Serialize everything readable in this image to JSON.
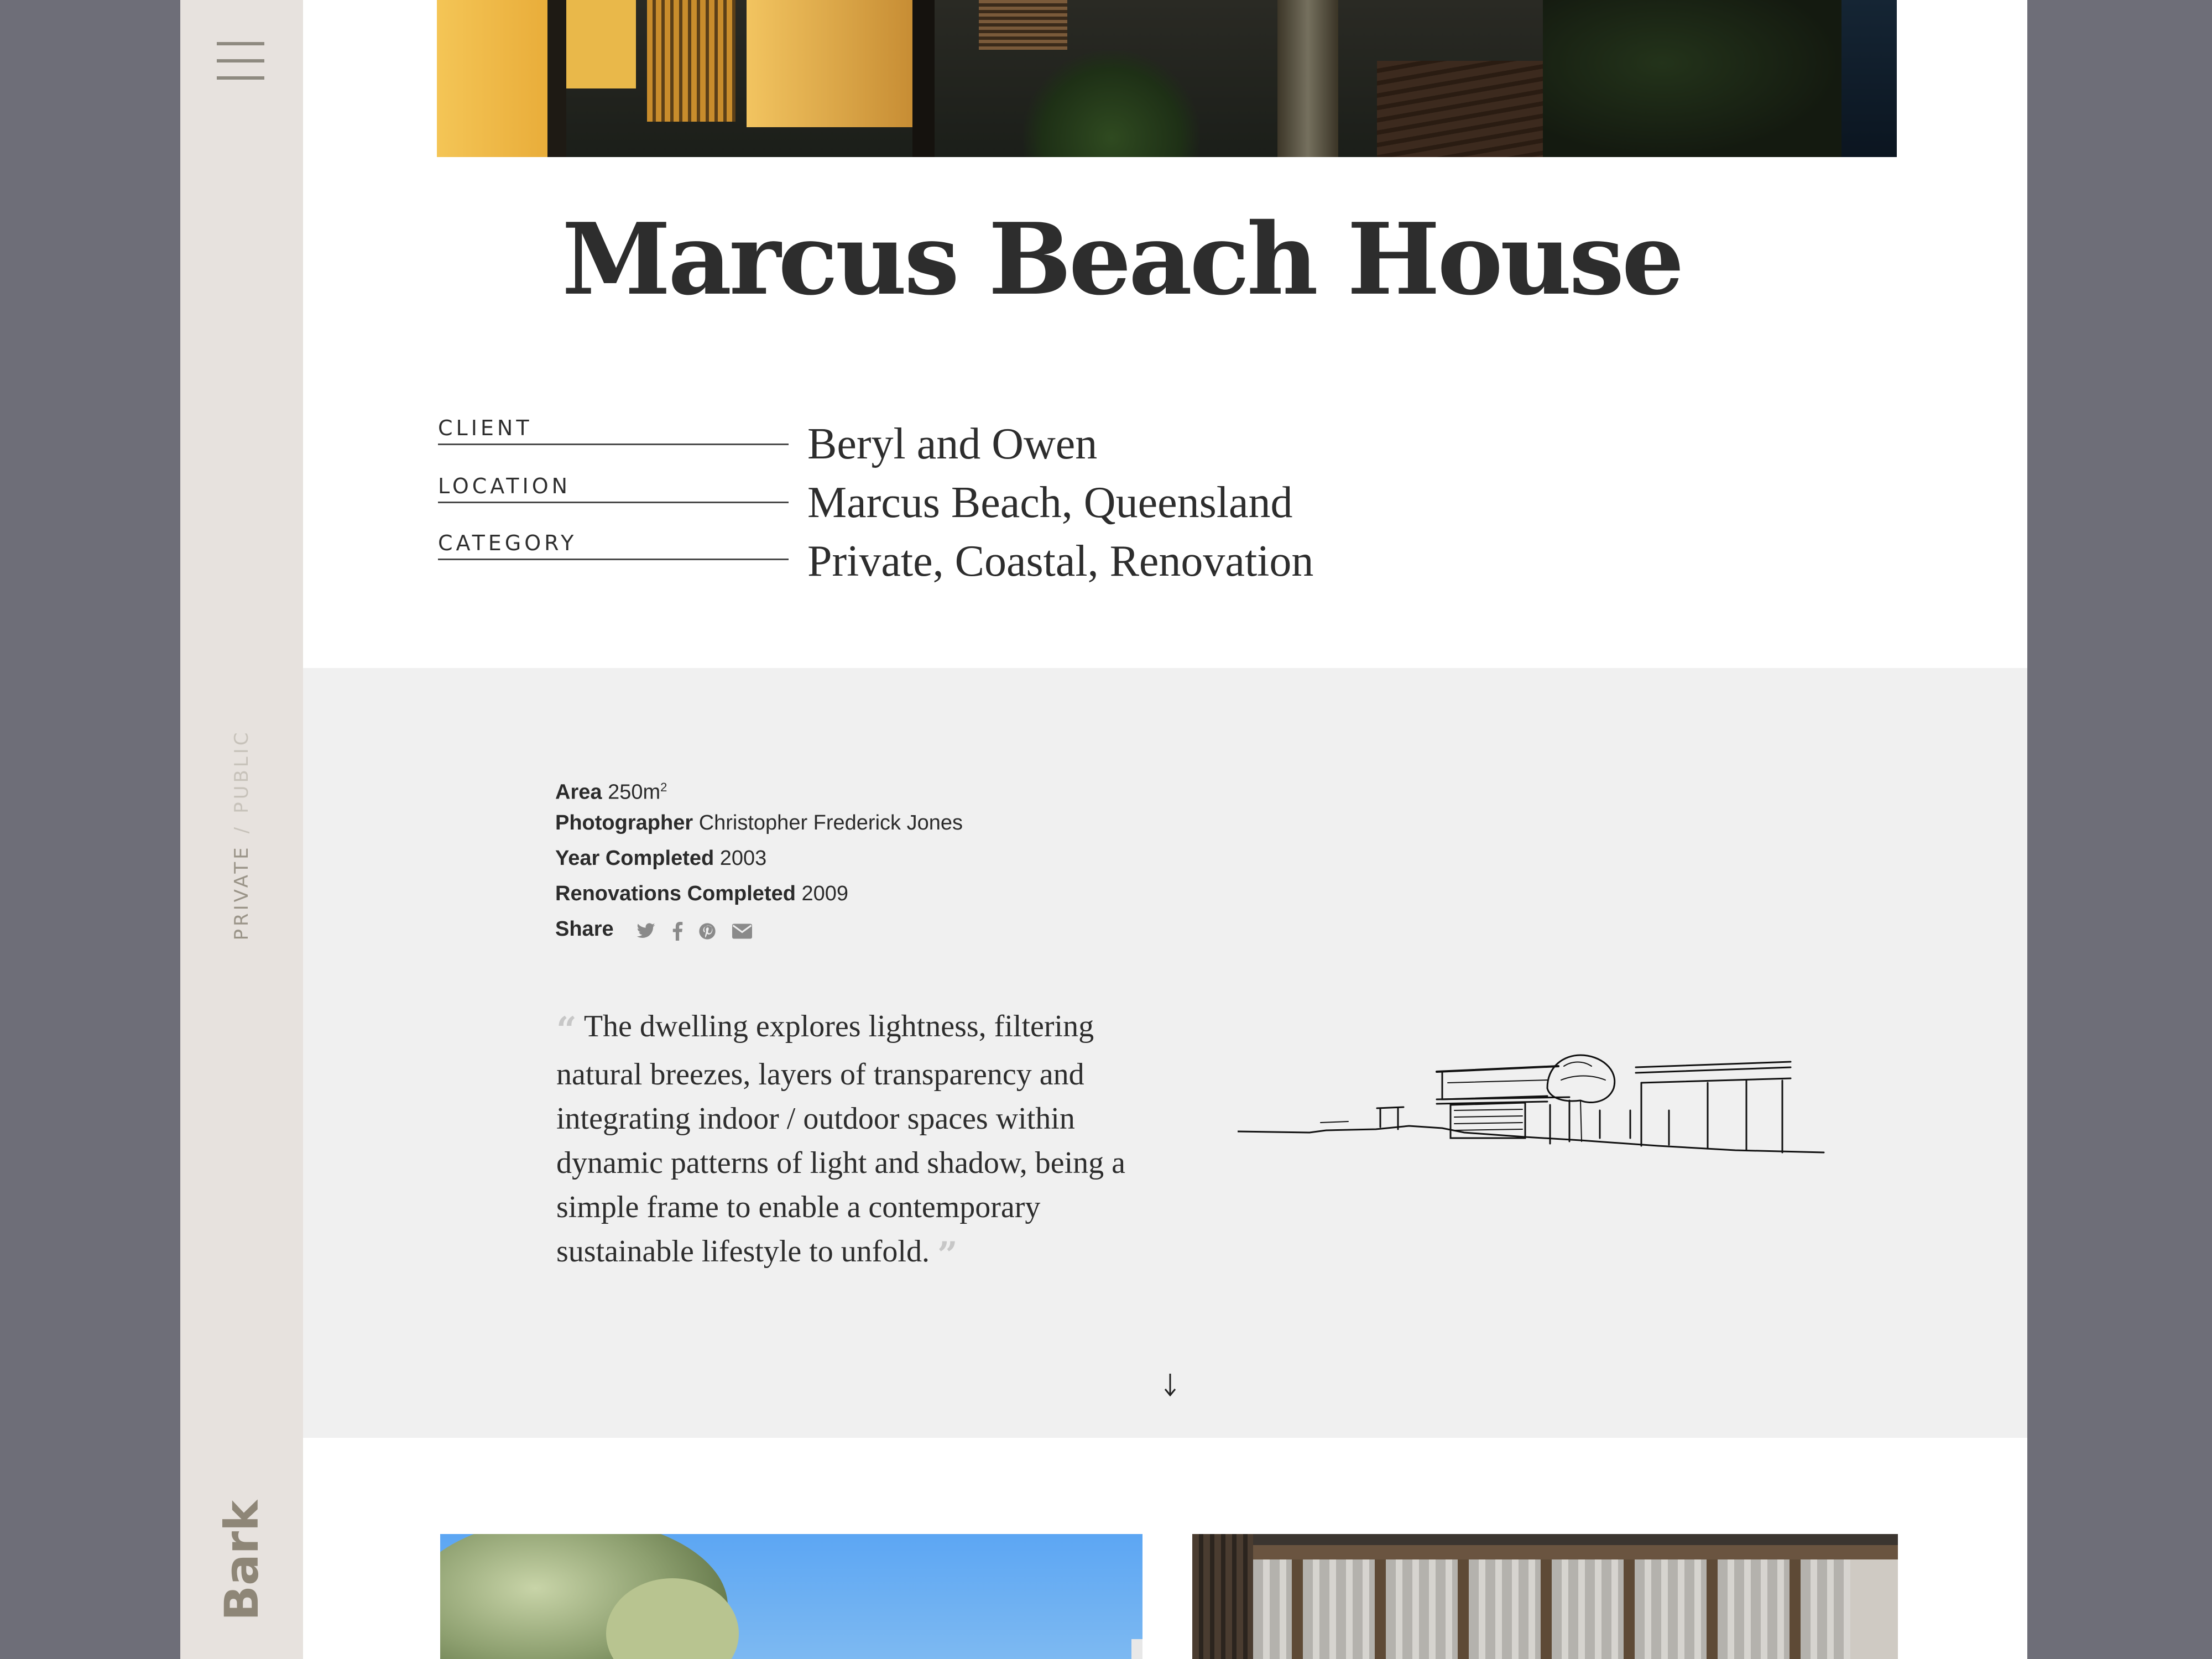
{
  "sidebar": {
    "filter": {
      "private": "PRIVATE",
      "separator": "/",
      "public": "PUBLIC"
    },
    "brand": "Bark",
    "menu_icon": "hamburger-menu-icon"
  },
  "hero": {
    "image": "house exterior at dusk with lit windows, timber deck and tree"
  },
  "project": {
    "title": "Marcus Beach House",
    "client_label": "CLIENT",
    "client": "Beryl and Owen",
    "location_label": "LOCATION",
    "location": "Marcus Beach, Queensland",
    "category_label": "CATEGORY",
    "category": "Private, Coastal, Renovation"
  },
  "details": {
    "area_label": "Area",
    "area_value": "250m",
    "area_sup": "2",
    "photographer_label": "Photographer",
    "photographer_value": "Christopher Frederick Jones",
    "year_label": "Year Completed",
    "year_value": "2003",
    "renovation_label": "Renovations Completed",
    "renovation_value": "2009",
    "share_label": "Share",
    "share_icons": [
      "twitter-icon",
      "facebook-icon",
      "pinterest-icon",
      "email-icon"
    ]
  },
  "quote": {
    "open": "“",
    "text": "The dwelling explores lightness, filtering natural breezes, layers of transparency and integrating indoor / outdoor spaces within dynamic patterns of light and shadow, being a simple frame to enable a contemporary sustainable lifestyle to unfold.",
    "close": "”"
  },
  "sketch": {
    "image": "pencil sketch of beach house"
  },
  "gallery": {
    "photos": [
      "trees against blue sky",
      "timber roof structure"
    ]
  },
  "colors": {
    "background": "#6e6e78",
    "sidebar": "#e7e2de",
    "panel": "#f0f0f0",
    "text": "#2d2d2d",
    "brand": "#8e8677"
  }
}
